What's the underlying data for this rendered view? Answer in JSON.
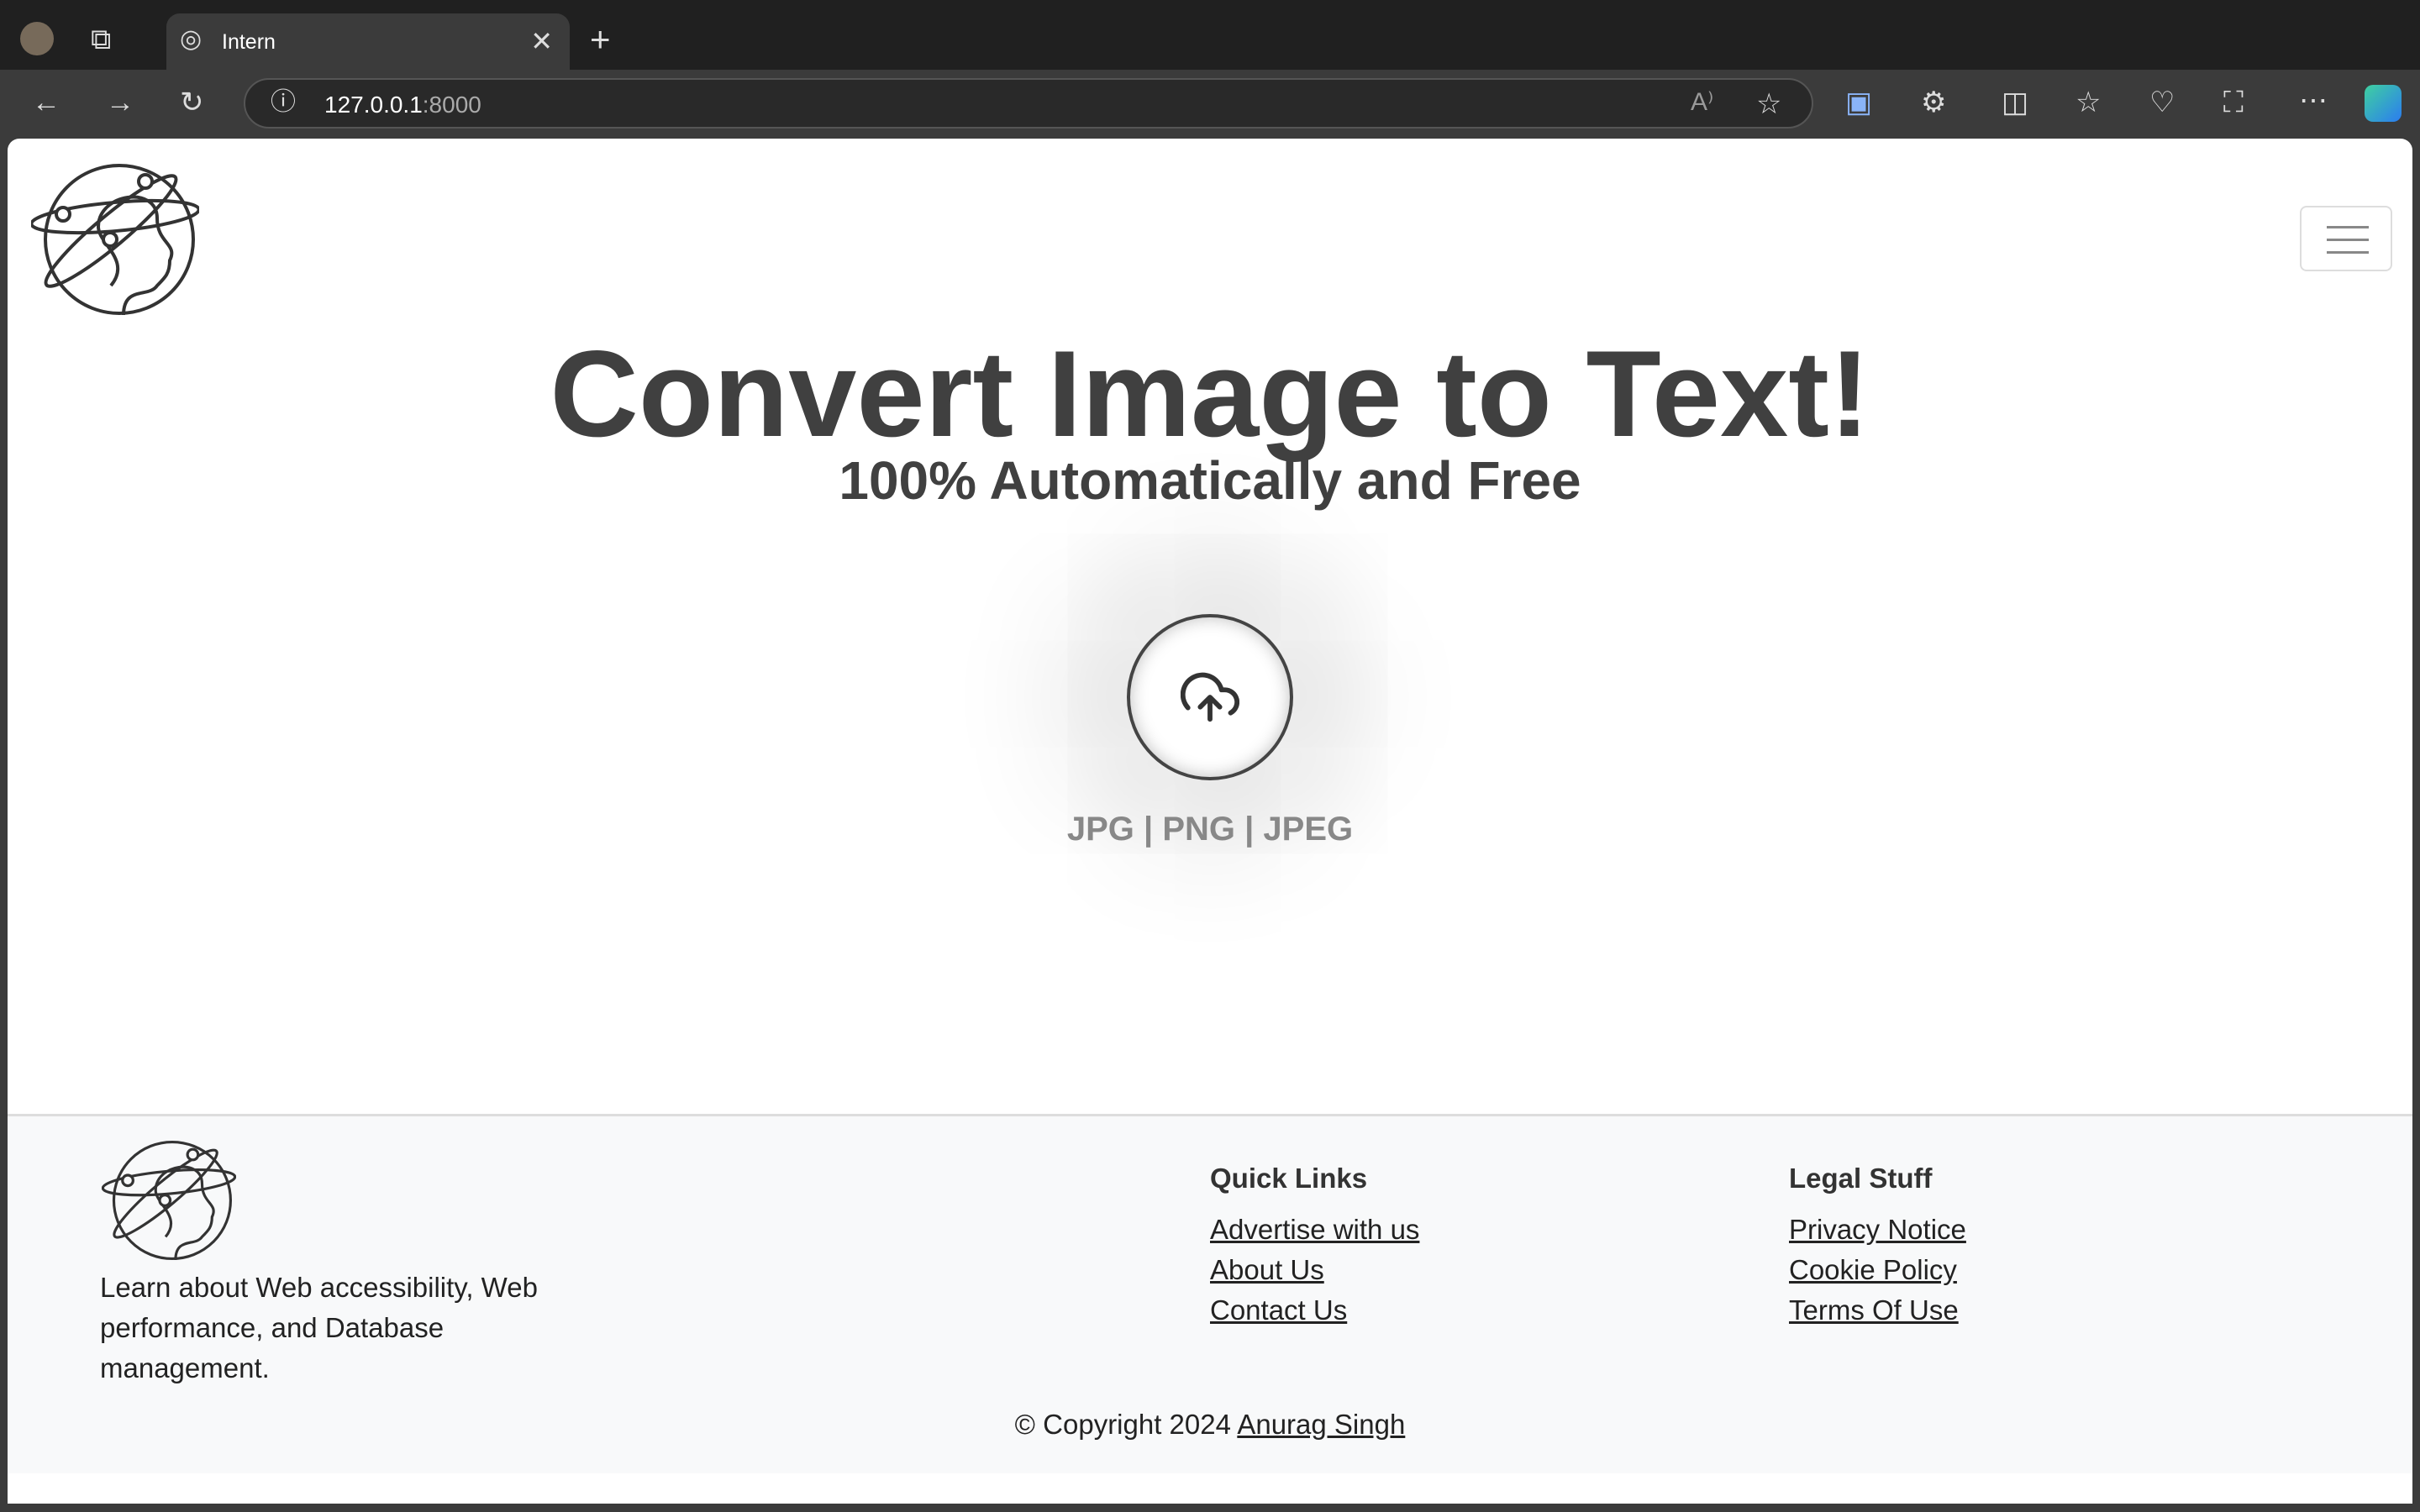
{
  "browser": {
    "tab_title": "Intern",
    "url_host": "127.0.0.1",
    "url_port": ":8000"
  },
  "hero": {
    "title": "Convert Image to Text!",
    "subtitle": "100% Automatically and Free",
    "formats": "JPG | PNG | JPEG",
    "upload_icon": "cloud-upload-icon"
  },
  "footer": {
    "about": "Learn about Web accessibility, Web performance, and Database management.",
    "quick_links": {
      "heading": "Quick Links",
      "items": [
        "Advertise with us",
        "About Us",
        "Contact Us"
      ]
    },
    "legal": {
      "heading": "Legal Stuff",
      "items": [
        "Privacy Notice",
        "Cookie Policy",
        "Terms Of Use"
      ]
    },
    "copyright": "© Copyright 2024",
    "author": "Anurag Singh"
  }
}
